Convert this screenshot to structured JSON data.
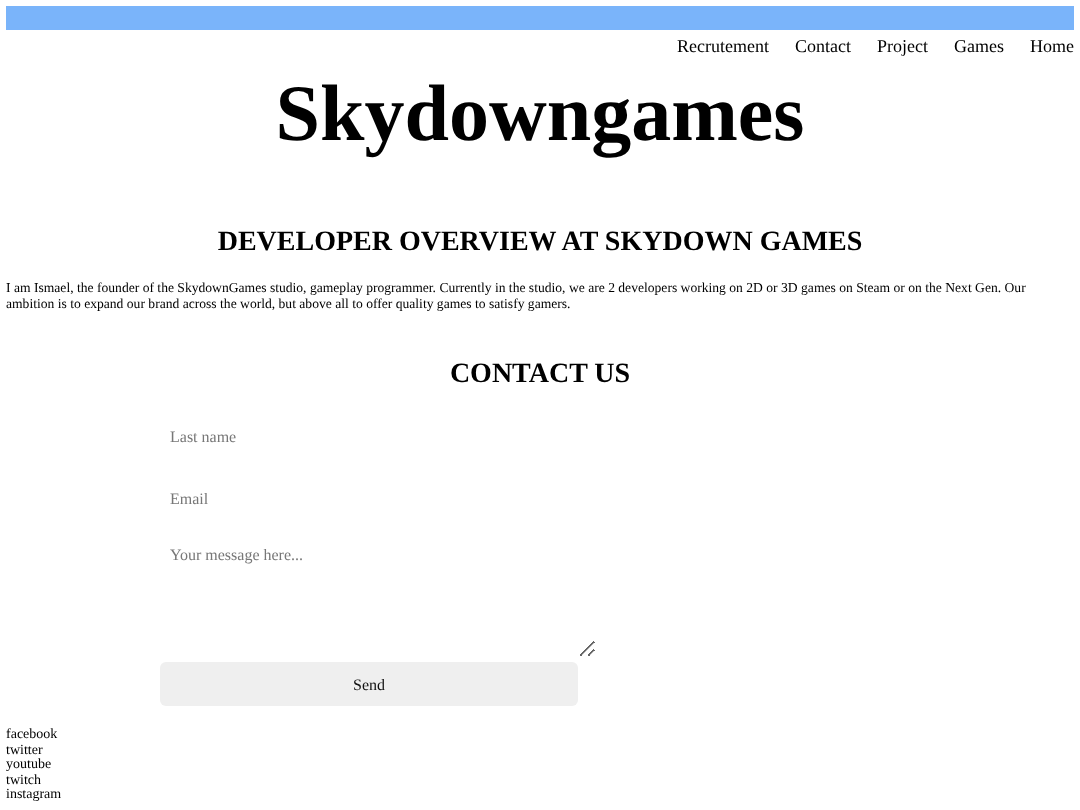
{
  "nav": {
    "items": [
      "Recrutement",
      "Contact",
      "Project",
      "Games",
      "Home"
    ]
  },
  "title": "Skydowngames",
  "overview": {
    "heading": "DEVELOPER OVERVIEW AT SKYDOWN GAMES",
    "text": "I am Ismael, the founder of the SkydownGames studio, gameplay programmer. Currently in the studio, we are 2 developers working on 2D or 3D games on Steam or on the Next Gen. Our ambition is to expand our brand across the world, but above all to offer quality games to satisfy gamers."
  },
  "contact": {
    "heading": "CONTACT US",
    "fields": [
      {
        "kind": "input",
        "placeholder": "Last name"
      },
      {
        "kind": "input",
        "placeholder": "Email"
      },
      {
        "kind": "textarea",
        "placeholder": "Your message here..."
      }
    ],
    "button": "Send"
  },
  "socials": [
    "facebook",
    "twitter",
    "youtube",
    "twitch",
    "instagram"
  ]
}
